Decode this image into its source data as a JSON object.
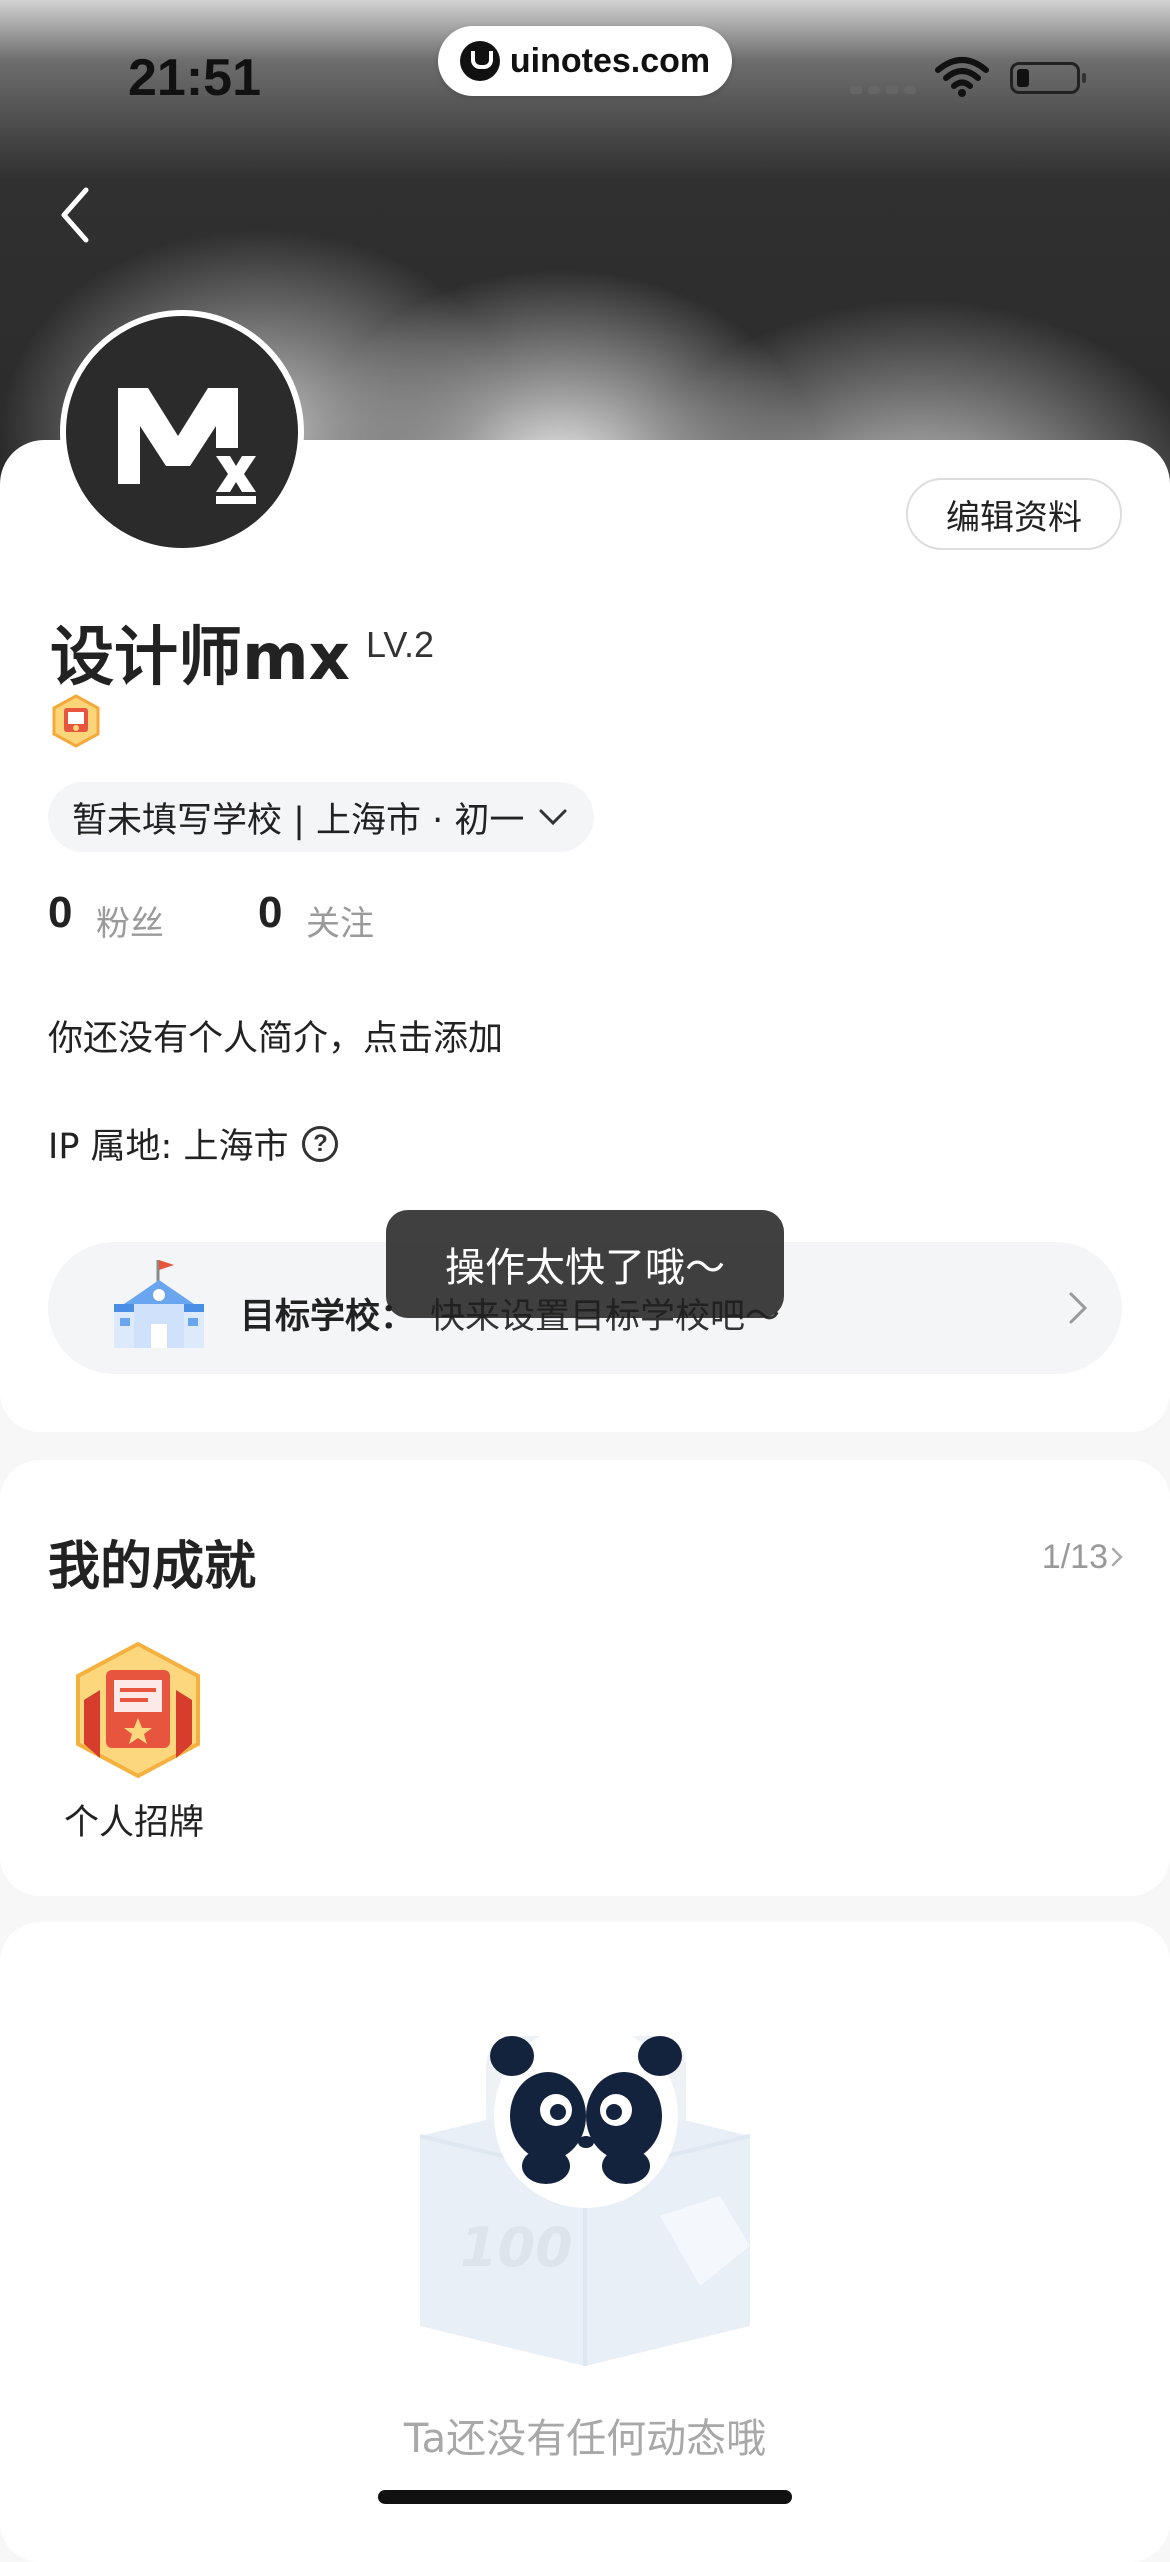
{
  "status_bar": {
    "time": "21:51",
    "url": "uinotes.com"
  },
  "profile": {
    "edit_label": "编辑资料",
    "username": "设计师mx",
    "level": "LV.2",
    "school_info": "暂未填写学校 | 上海市 · 初一",
    "followers_count": "0",
    "followers_label": "粉丝",
    "following_count": "0",
    "following_label": "关注",
    "bio": "你还没有个人简介，点击添加",
    "ip_location": "IP 属地: 上海市",
    "target_school_label": "目标学校：",
    "target_school_value": "快来设置目标学校吧～"
  },
  "toast": {
    "text": "操作太快了哦～"
  },
  "achievements": {
    "title": "我的成就",
    "count": "1/13",
    "badges": [
      {
        "label": "个人招牌",
        "icon": "signboard-badge-icon"
      }
    ]
  },
  "feed": {
    "empty_text": "Ta还没有任何动态哦"
  },
  "colors": {
    "accent_orange": "#f5a93a",
    "badge_red": "#e8553f",
    "panda_dark": "#14233d"
  }
}
